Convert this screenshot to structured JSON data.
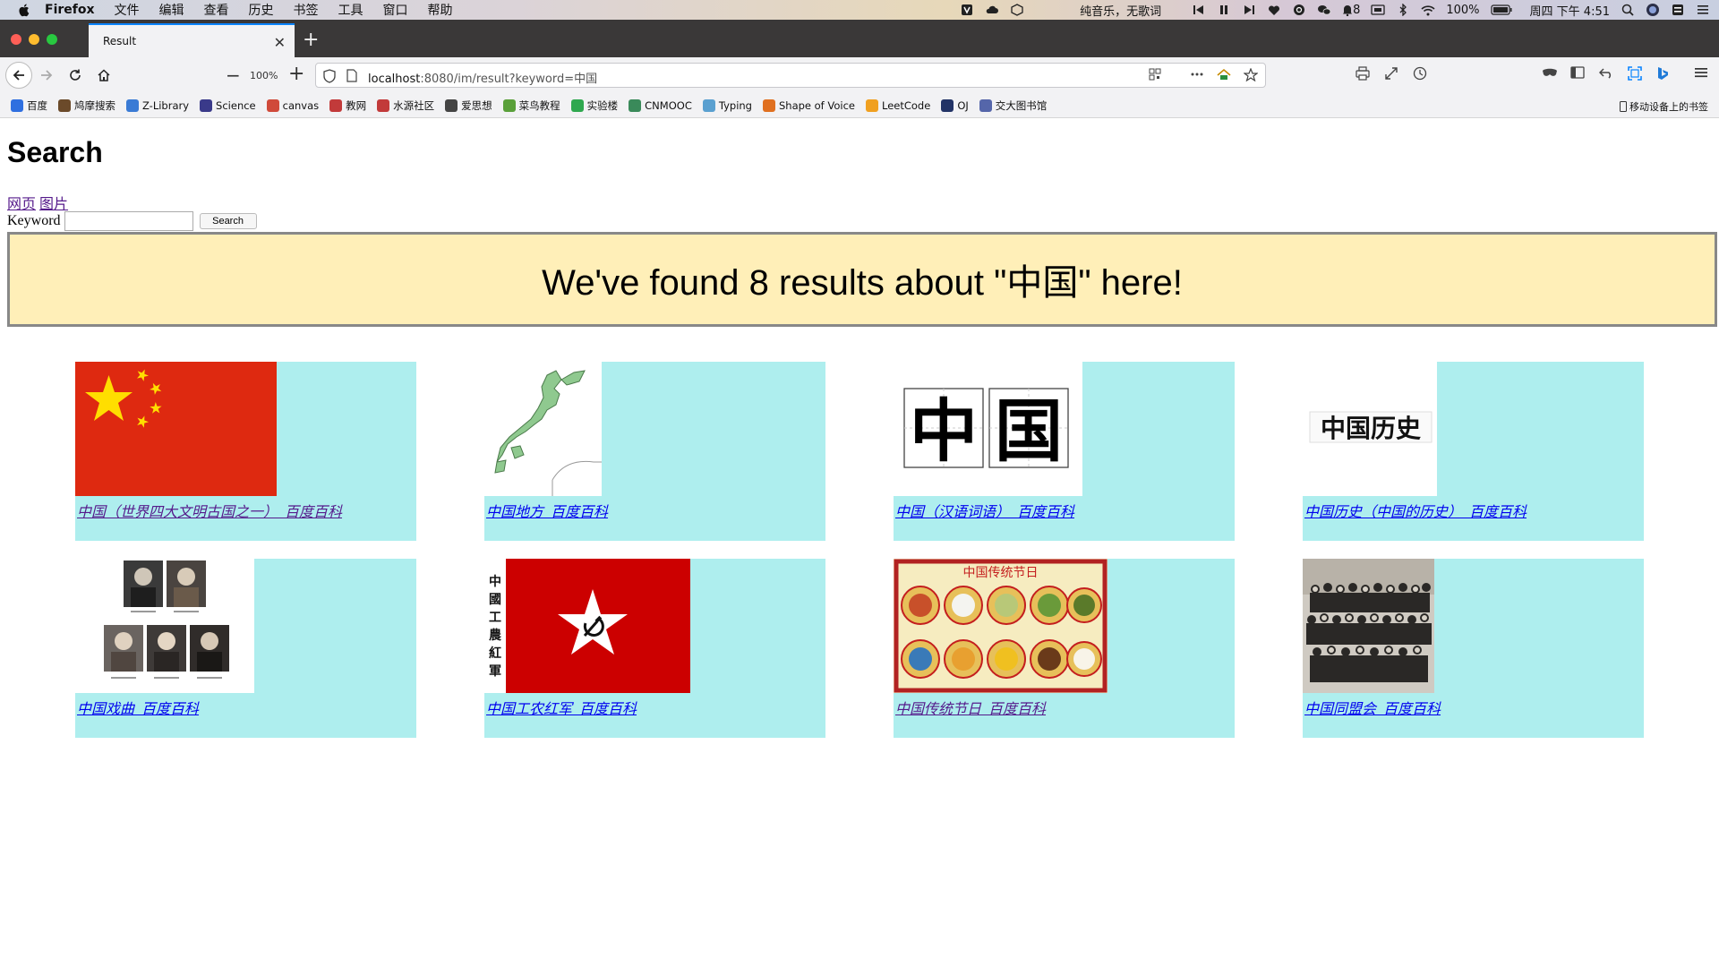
{
  "menubar": {
    "app_name": "Firefox",
    "menus": [
      "文件",
      "编辑",
      "查看",
      "历史",
      "书签",
      "工具",
      "窗口",
      "帮助"
    ],
    "now_playing": "纯音乐，无歌词",
    "notification_count": "8",
    "battery": "100%",
    "clock": "周四 下午 4:51"
  },
  "browser": {
    "tab_title": "Result",
    "zoom": "100%",
    "url_host": "localhost",
    "url_rest": ":8080/im/result?keyword=中国",
    "mobile_bookmarks": "移动设备上的书签",
    "bookmarks": [
      {
        "label": "百度",
        "color": "#2f6fe0"
      },
      {
        "label": "鸠摩搜索",
        "color": "#6b4a2a"
      },
      {
        "label": "Z-Library",
        "color": "#3a7bd5"
      },
      {
        "label": "Science",
        "color": "#3a3a8a"
      },
      {
        "label": "canvas",
        "color": "#d04a3a"
      },
      {
        "label": "教网",
        "color": "#c23a3a"
      },
      {
        "label": "水源社区",
        "color": "#c23a3a"
      },
      {
        "label": "爱思想",
        "color": "#444444"
      },
      {
        "label": "菜鸟教程",
        "color": "#5aa03a"
      },
      {
        "label": "实验楼",
        "color": "#2fa84f"
      },
      {
        "label": "CNMOOC",
        "color": "#3a8a5a"
      },
      {
        "label": "Typing",
        "color": "#5aa0d0"
      },
      {
        "label": "Shape of Voice",
        "color": "#e07020"
      },
      {
        "label": "LeetCode",
        "color": "#f0a020"
      },
      {
        "label": "OJ",
        "color": "#223366"
      },
      {
        "label": "交大图书馆",
        "color": "#5566aa"
      }
    ]
  },
  "page": {
    "title": "Search",
    "links": [
      "网页",
      "图片"
    ],
    "keyword_label": "Keyword",
    "keyword_value": "",
    "search_button": "Search",
    "banner": "We've found 8 results about \"中国\" here!",
    "results": [
      {
        "caption": "中国（世界四大文明古国之一）_百度百科",
        "image": "china-flag",
        "visited": true
      },
      {
        "caption": "中国地方_百度百科",
        "image": "japan-map",
        "visited": false
      },
      {
        "caption": "中国（汉语词语）_百度百科",
        "image": "zhongguo-characters",
        "visited": false,
        "image_text": "中国"
      },
      {
        "caption": "中国历史（中国的历史）_百度百科",
        "image": "history-characters",
        "visited": false,
        "image_text": "中国历史"
      },
      {
        "caption": "中国戏曲_百度百科",
        "image": "opera-portraits",
        "visited": false
      },
      {
        "caption": "中国工农红军_百度百科",
        "image": "red-army-flag",
        "visited": false,
        "image_text": "中國工農紅軍"
      },
      {
        "caption": "中国传统节日_百度百科",
        "image": "traditional-festivals",
        "visited": true,
        "image_text": "中国传统节日"
      },
      {
        "caption": "中国同盟会_百度百科",
        "image": "tongmenghui-photo",
        "visited": false
      }
    ]
  }
}
